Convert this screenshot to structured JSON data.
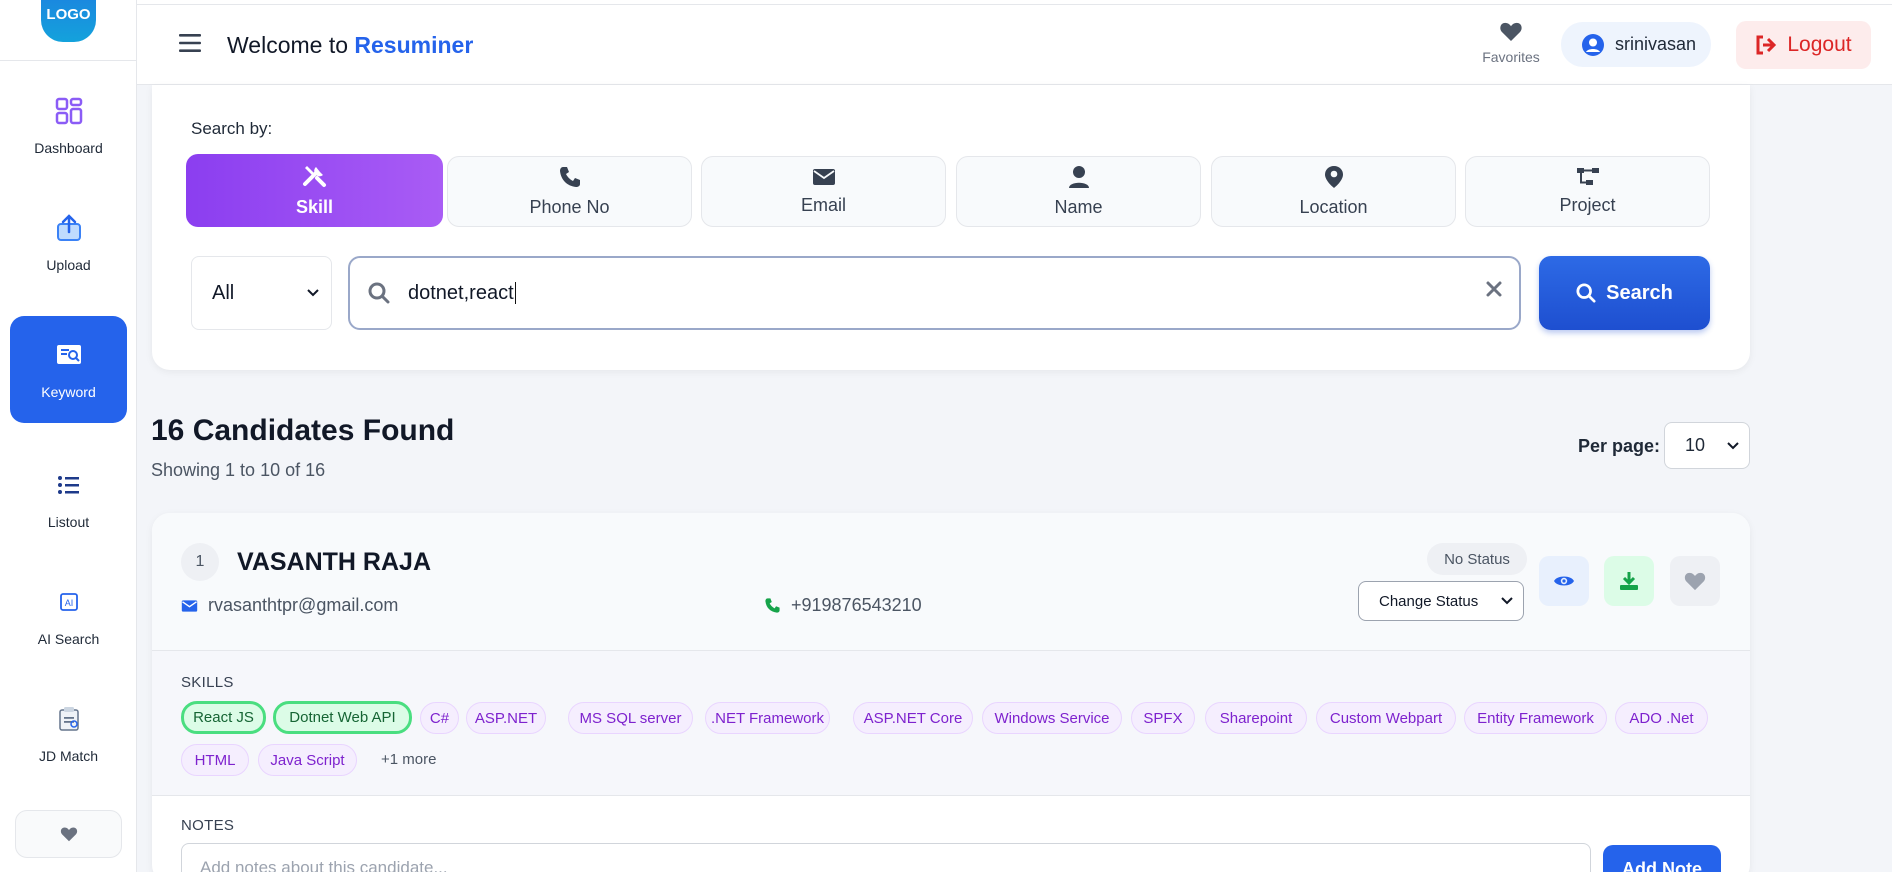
{
  "sidebar": {
    "logo": "LOGO",
    "items": [
      {
        "label": "Dashboard",
        "icon": "dashboard-icon"
      },
      {
        "label": "Upload",
        "icon": "upload-icon"
      },
      {
        "label": "Keyword",
        "icon": "keyword-icon",
        "active": true
      },
      {
        "label": "Listout",
        "icon": "list-icon"
      },
      {
        "label": "AI Search",
        "icon": "ai-search-icon"
      },
      {
        "label": "JD Match",
        "icon": "jd-match-icon"
      }
    ]
  },
  "header": {
    "welcome_prefix": "Welcome to",
    "brand": "Resuminer",
    "favorites_label": "Favorites",
    "username": "srinivasan",
    "logout_label": "Logout"
  },
  "search": {
    "search_by_label": "Search by:",
    "tabs": [
      {
        "label": "Skill",
        "icon": "tools-icon",
        "active": true
      },
      {
        "label": "Phone No",
        "icon": "phone-icon"
      },
      {
        "label": "Email",
        "icon": "envelope-icon"
      },
      {
        "label": "Name",
        "icon": "user-icon"
      },
      {
        "label": "Location",
        "icon": "map-pin-icon"
      },
      {
        "label": "Project",
        "icon": "project-tree-icon"
      }
    ],
    "scope_value": "All",
    "query": "dotnet,react",
    "button_label": "Search"
  },
  "results": {
    "title": "16 Candidates Found",
    "subtitle": "Showing 1 to 10 of 16",
    "per_page_label": "Per page:",
    "per_page_value": "10"
  },
  "candidate": {
    "rank": "1",
    "name": "VASANTH RAJA",
    "email": "rvasanthtpr@gmail.com",
    "phone": "+919876543210",
    "status": "No Status",
    "change_status_label": "Change Status",
    "skills_title": "SKILLS",
    "skills": [
      "React JS",
      "Dotnet Web API",
      "C#",
      "ASP.NET",
      "MS SQL server",
      ".NET Framework",
      "ASP.NET Core",
      "Windows Service",
      "SPFX",
      "Sharepoint",
      "Custom Webpart",
      "Entity Framework",
      "ADO .Net",
      "HTML",
      "Java Script"
    ],
    "more_label": "+1 more",
    "notes_title": "NOTES",
    "notes_placeholder": "Add notes about this candidate...",
    "add_note_label": "Add Note"
  },
  "colors": {
    "primary": "#2563eb",
    "accent_purple": "#9333ea",
    "logout_red": "#dc2626",
    "match_green": "#4ade80"
  }
}
